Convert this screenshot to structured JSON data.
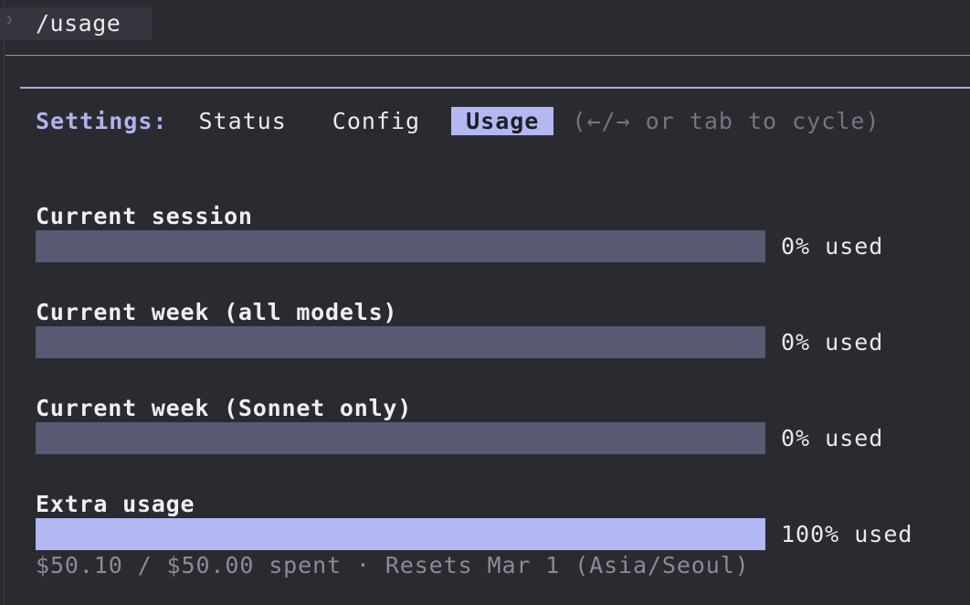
{
  "prompt": {
    "command": "/usage"
  },
  "tabs": {
    "settings_label": "Settings:",
    "items": [
      "Status",
      "Config",
      "Usage"
    ],
    "active_index": 2,
    "hint": "(←/→ or tab to cycle)"
  },
  "meters": [
    {
      "label": "Current session",
      "percent_text": "0% used",
      "fill_fraction": 0
    },
    {
      "label": "Current week (all models)",
      "percent_text": "0% used",
      "fill_fraction": 0
    },
    {
      "label": "Current week (Sonnet only)",
      "percent_text": "0% used",
      "fill_fraction": 0
    },
    {
      "label": "Extra usage",
      "percent_text": "100% used",
      "fill_fraction": 1,
      "footnote": "$50.10 / $50.00 spent · Resets Mar 1 (Asia/Seoul)"
    }
  ],
  "colors": {
    "accent": "#b3b7f2",
    "bar_empty": "#585a73",
    "background": "#2a2b31",
    "muted_text": "#8a8c95"
  }
}
